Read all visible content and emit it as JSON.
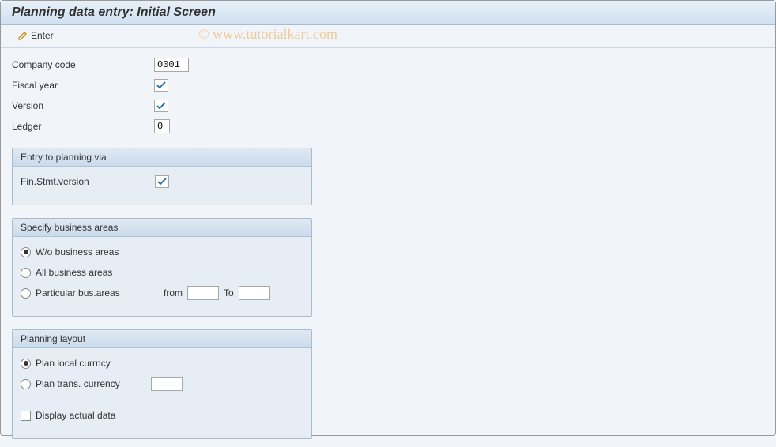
{
  "title": "Planning data entry: Initial Screen",
  "toolbar": {
    "enter_label": "Enter"
  },
  "watermark": "© www.tutorialkart.com",
  "fields": {
    "company_code_label": "Company code",
    "company_code_value": "0001",
    "fiscal_year_label": "Fiscal year",
    "version_label": "Version",
    "ledger_label": "Ledger",
    "ledger_value": "0"
  },
  "group_entry": {
    "title": "Entry to planning via",
    "fin_stmt_label": "Fin.Stmt.version"
  },
  "group_business": {
    "title": "Specify business areas",
    "opt_without": "W/o business areas",
    "opt_all": "All business areas",
    "opt_particular": "Particular bus.areas",
    "from_label": "from",
    "to_label": "To"
  },
  "group_layout": {
    "title": "Planning layout",
    "opt_local": "Plan local currncy",
    "opt_trans": "Plan trans. currency",
    "display_actual": "Display actual data"
  }
}
